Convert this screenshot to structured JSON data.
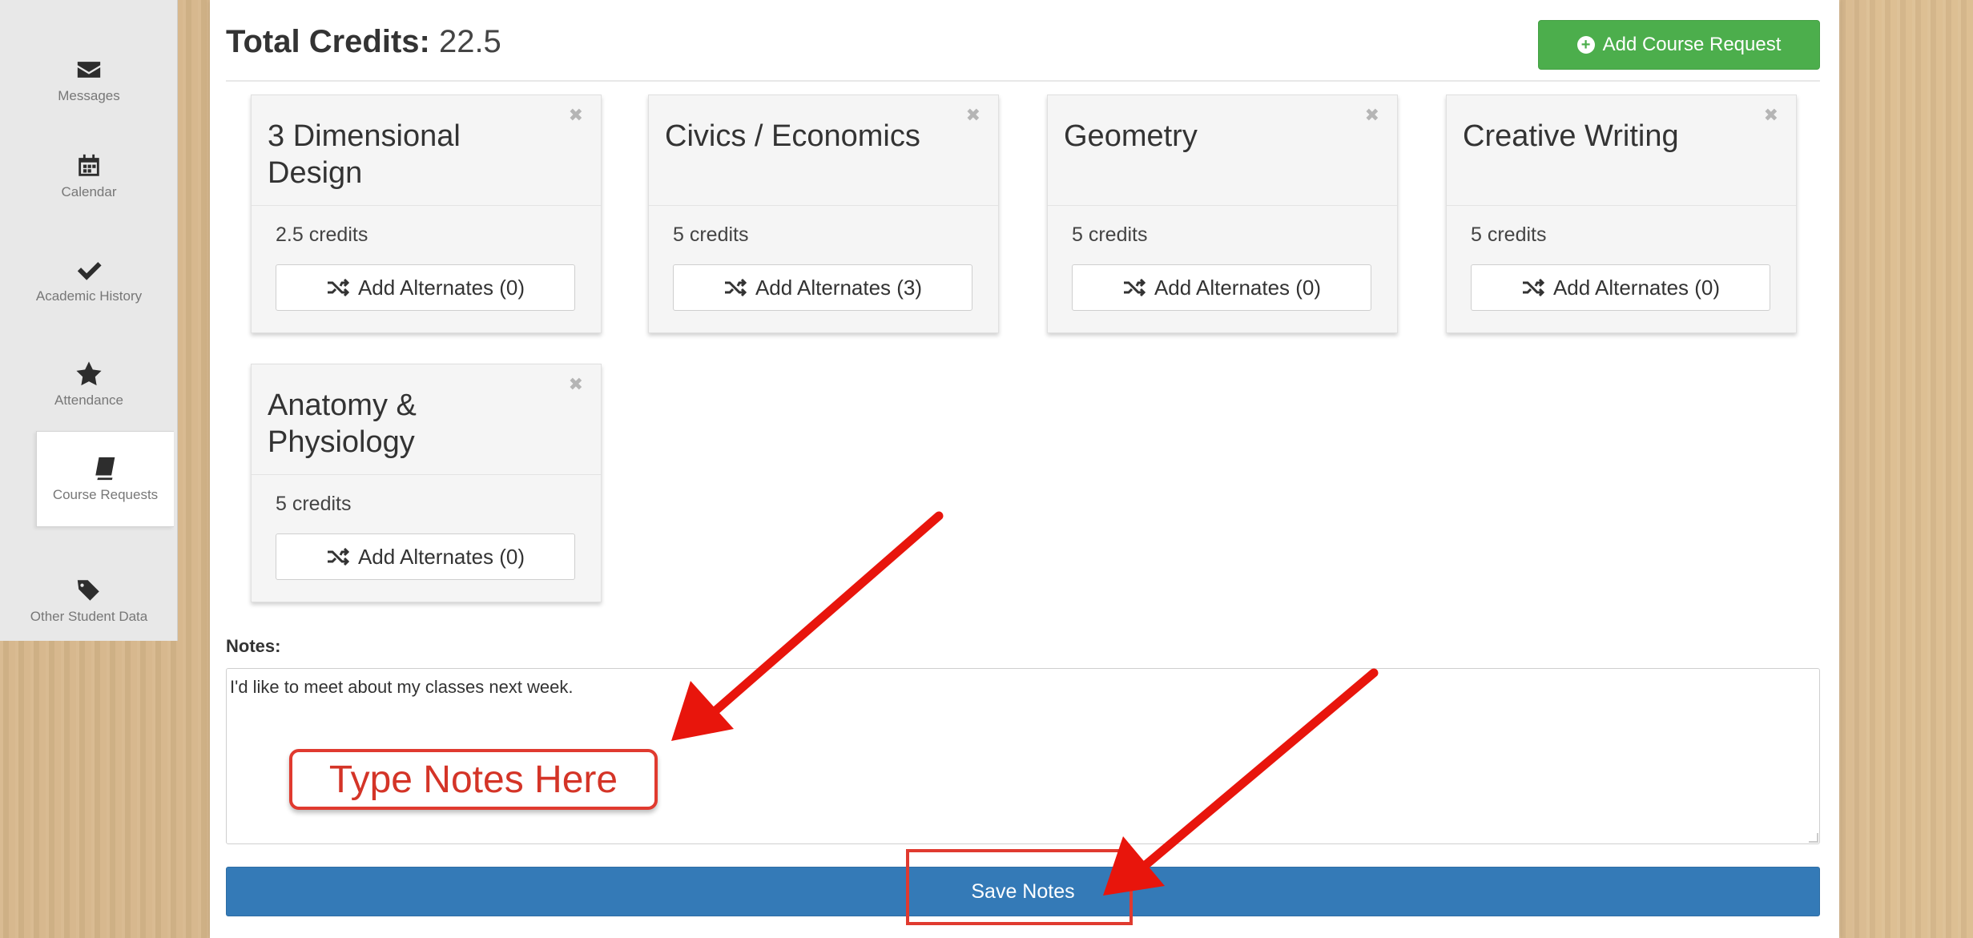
{
  "sidebar": {
    "items": [
      {
        "label": "Messages",
        "icon": "envelope-icon"
      },
      {
        "label": "Calendar",
        "icon": "calendar-icon"
      },
      {
        "label": "Academic History",
        "icon": "checkmark-icon"
      },
      {
        "label": "Attendance",
        "icon": "star-icon"
      },
      {
        "label": "Course Requests",
        "icon": "book-icon",
        "active": true
      },
      {
        "label": "Other Student Data",
        "icon": "tags-icon"
      }
    ]
  },
  "header": {
    "title_label": "Total Credits:",
    "title_value": "22.5",
    "add_course_label": "Add Course Request"
  },
  "courses": [
    {
      "name": "3 Dimensional Design",
      "credits": "2.5 credits",
      "alternates": "Add Alternates (0)"
    },
    {
      "name": "Civics / Economics",
      "credits": "5 credits",
      "alternates": "Add Alternates (3)"
    },
    {
      "name": "Geometry",
      "credits": "5 credits",
      "alternates": "Add Alternates (0)"
    },
    {
      "name": "Creative Writing",
      "credits": "5 credits",
      "alternates": "Add Alternates (0)"
    },
    {
      "name": "Anatomy & Physiology",
      "credits": "5 credits",
      "alternates": "Add Alternates (0)"
    }
  ],
  "notes": {
    "label": "Notes:",
    "value": "I'd like to meet about my classes next week."
  },
  "annotation": {
    "callout_text": "Type Notes Here",
    "color": "#e03a2f"
  },
  "save_label": "Save Notes",
  "colors": {
    "primary": "#347ab7",
    "success": "#4cae4c"
  }
}
